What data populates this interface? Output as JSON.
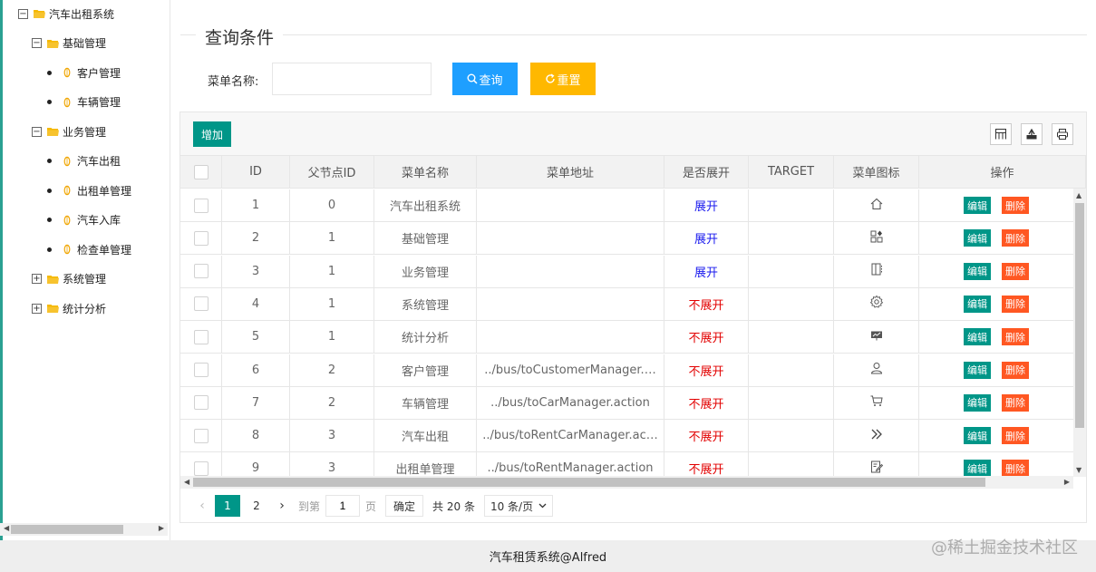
{
  "sidebar": {
    "root": {
      "label": "汽车出租系统",
      "toggle": "−"
    },
    "groups": [
      {
        "label": "基础管理",
        "toggle": "−",
        "children": [
          "客户管理",
          "车辆管理"
        ]
      },
      {
        "label": "业务管理",
        "toggle": "−",
        "children": [
          "汽车出租",
          "出租单管理",
          "汽车入库",
          "检查单管理"
        ]
      },
      {
        "label": "系统管理",
        "toggle": "+",
        "children": []
      },
      {
        "label": "统计分析",
        "toggle": "+",
        "children": []
      }
    ]
  },
  "search": {
    "legend": "查询条件",
    "label": "菜单名称:",
    "value": "",
    "placeholder": "",
    "query_label": "查询",
    "reset_label": "重置"
  },
  "toolbar": {
    "add_label": "增加",
    "icons": [
      "columns-icon",
      "export-icon",
      "print-icon"
    ]
  },
  "table": {
    "columns": [
      "ID",
      "父节点ID",
      "菜单名称",
      "菜单地址",
      "是否展开",
      "TARGET",
      "菜单图标",
      "操作"
    ],
    "edit_label": "编辑",
    "delete_label": "删除",
    "rows": [
      {
        "id": "1",
        "pid": "0",
        "name": "汽车出租系统",
        "href": "",
        "spread": "展开",
        "open": true,
        "target": "",
        "icon": "home-icon"
      },
      {
        "id": "2",
        "pid": "1",
        "name": "基础管理",
        "href": "",
        "spread": "展开",
        "open": true,
        "target": "",
        "icon": "app-icon"
      },
      {
        "id": "3",
        "pid": "1",
        "name": "业务管理",
        "href": "",
        "spread": "展开",
        "open": true,
        "target": "",
        "icon": "template-icon"
      },
      {
        "id": "4",
        "pid": "1",
        "name": "系统管理",
        "href": "",
        "spread": "不展开",
        "open": false,
        "target": "",
        "icon": "gear-icon"
      },
      {
        "id": "5",
        "pid": "1",
        "name": "统计分析",
        "href": "",
        "spread": "不展开",
        "open": false,
        "target": "",
        "icon": "chart-screen-icon"
      },
      {
        "id": "6",
        "pid": "2",
        "name": "客户管理",
        "href": "../bus/toCustomerManager.…",
        "spread": "不展开",
        "open": false,
        "target": "",
        "icon": "user-icon"
      },
      {
        "id": "7",
        "pid": "2",
        "name": "车辆管理",
        "href": "../bus/toCarManager.action",
        "spread": "不展开",
        "open": false,
        "target": "",
        "icon": "cart-icon"
      },
      {
        "id": "8",
        "pid": "3",
        "name": "汽车出租",
        "href": "../bus/toRentCarManager.ac…",
        "spread": "不展开",
        "open": false,
        "target": "",
        "icon": "double-right-icon"
      },
      {
        "id": "9",
        "pid": "3",
        "name": "出租单管理",
        "href": "../bus/toRentManager.action",
        "spread": "不展开",
        "open": false,
        "target": "",
        "icon": "edit-doc-icon"
      }
    ]
  },
  "pager": {
    "pages": [
      "1",
      "2"
    ],
    "current": "1",
    "goto_label": "到第",
    "goto_value": "1",
    "page_unit": "页",
    "confirm_label": "确定",
    "total_label": "共 20 条",
    "size_label": "10 条/页"
  },
  "footer": {
    "text": "汽车租赁系统@Alfred"
  },
  "watermark": "@稀土掘金技术社区",
  "colors": {
    "primary": "#009688",
    "blue": "#1e9fff",
    "orange": "#ffb800",
    "danger": "#ff5722",
    "sidebar_accent": "#2aa092"
  }
}
